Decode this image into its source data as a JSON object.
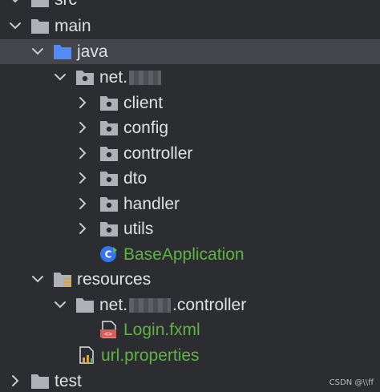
{
  "tree": {
    "src": "src",
    "main": "main",
    "java": "java",
    "package_prefix": "net.",
    "client": "client",
    "config": "config",
    "controller": "controller",
    "dto": "dto",
    "handler": "handler",
    "utils": "utils",
    "base_application": "BaseApplication",
    "resources": "resources",
    "res_package_prefix": "net.",
    "res_package_suffix": ".controller",
    "login_fxml": "Login.fxml",
    "url_properties": "url.properties",
    "test": "test"
  },
  "watermark": "CSDN @\\\\ff",
  "colors": {
    "background": "#2b2d30",
    "selection": "#43454a",
    "text": "#dfe1e5",
    "green_text": "#5fb340",
    "folder_grey": "#aeb1b6",
    "folder_blue": "#548af7"
  },
  "icons": {
    "expanded": "chevron-down-icon",
    "collapsed": "chevron-right-icon",
    "folder": "folder-icon",
    "source_folder": "source-folder-icon",
    "package": "package-icon",
    "resources_folder": "resources-folder-icon",
    "java_class": "java-class-icon",
    "fxml_file": "fxml-file-icon",
    "properties_file": "properties-file-icon"
  }
}
